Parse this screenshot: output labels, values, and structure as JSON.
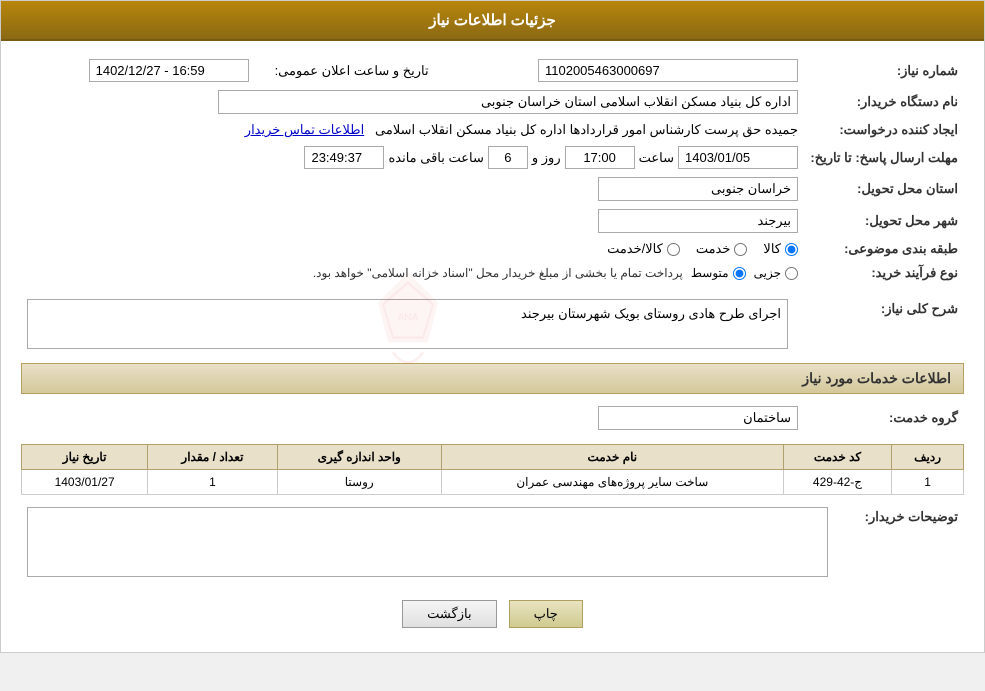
{
  "header": {
    "title": "جزئیات اطلاعات نیاز"
  },
  "fields": {
    "need_number_label": "شماره نیاز:",
    "need_number_value": "1102005463000697",
    "buyer_org_label": "نام دستگاه خریدار:",
    "buyer_org_value": "اداره کل بنیاد مسکن انقلاب اسلامی استان خراسان جنوبی",
    "creator_label": "ایجاد کننده درخواست:",
    "creator_value": "جمیده حق پرست کارشناس امور قراردادها اداره کل بنیاد مسکن انقلاب اسلامی",
    "creator_link": "اطلاعات تماس خریدار",
    "announce_label": "تاریخ و ساعت اعلان عمومی:",
    "announce_value": "1402/12/27 - 16:59",
    "reply_deadline_label": "مهلت ارسال پاسخ: تا تاریخ:",
    "reply_date": "1403/01/05",
    "reply_time_label": "ساعت",
    "reply_time": "17:00",
    "reply_days_label": "روز و",
    "reply_days": "6",
    "reply_remaining_label": "ساعت باقی مانده",
    "reply_remaining": "23:49:37",
    "delivery_province_label": "استان محل تحویل:",
    "delivery_province": "خراسان جنوبی",
    "delivery_city_label": "شهر محل تحویل:",
    "delivery_city": "بیرجند",
    "category_label": "طبقه بندی موضوعی:",
    "category_options": [
      "کالا",
      "خدمت",
      "کالا/خدمت"
    ],
    "category_selected": "کالا",
    "purchase_type_label": "نوع فرآیند خرید:",
    "purchase_type_options": [
      "جزیی",
      "متوسط"
    ],
    "purchase_type_selected": "متوسط",
    "purchase_type_note": "پرداخت تمام یا بخشی از مبلغ خریدار محل \"اسناد خزانه اسلامی\" خواهد بود.",
    "need_desc_label": "شرح کلی نیاز:",
    "need_desc_value": "اجرای طرح هادی روستای بویک شهرستان بیرجند",
    "services_title": "اطلاعات خدمات مورد نیاز",
    "service_group_label": "گروه خدمت:",
    "service_group_value": "ساختمان",
    "table_headers": [
      "ردیف",
      "کد خدمت",
      "نام خدمت",
      "واحد اندازه گیری",
      "تعداد / مقدار",
      "تاریخ نیاز"
    ],
    "table_rows": [
      {
        "row": "1",
        "code": "ج-42-429",
        "name": "ساخت سایر پروژه‌های مهندسی عمران",
        "unit": "روستا",
        "qty": "1",
        "date": "1403/01/27"
      }
    ],
    "buyer_desc_label": "توضیحات خریدار:",
    "print_btn": "چاپ",
    "back_btn": "بازگشت"
  }
}
